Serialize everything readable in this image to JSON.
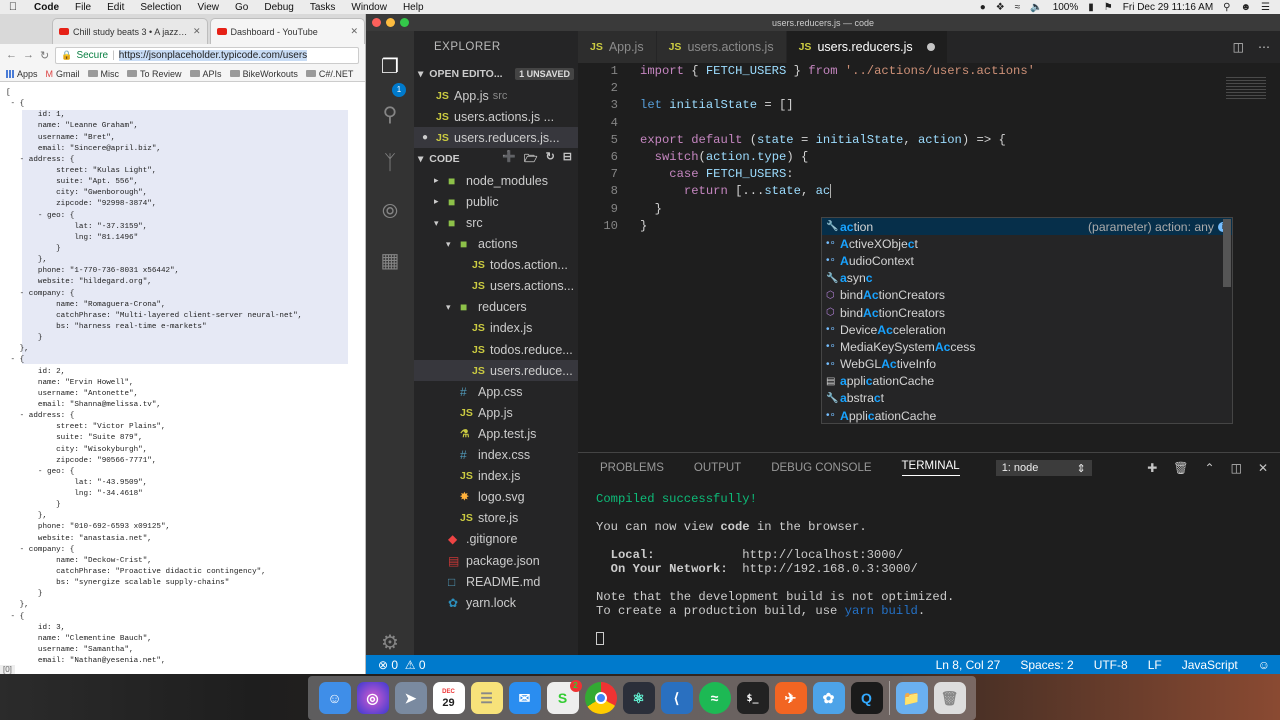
{
  "menubar": {
    "app": "Code",
    "items": [
      "File",
      "Edit",
      "Selection",
      "View",
      "Go",
      "Debug",
      "Tasks",
      "Window",
      "Help"
    ],
    "battery": "100%",
    "clock": "Fri Dec 29  11:16 AM"
  },
  "chrome": {
    "tabs": [
      {
        "title": "Chill study beats 3 • A jazz & l"
      },
      {
        "title": "Dashboard - YouTube"
      }
    ],
    "secure_label": "Secure",
    "url": "https://jsonplaceholder.typicode.com/users",
    "bookmarks": [
      "Apps",
      "Gmail",
      "Misc",
      "To Review",
      "APIs",
      "BikeWorkouts",
      "C#/.NET"
    ],
    "status": "[0]",
    "json_lines": [
      "[",
      " - {",
      "       id: 1,",
      "       name: \"Leanne Graham\",",
      "       username: \"Bret\",",
      "       email: \"Sincere@april.biz\",",
      "   - address: {",
      "           street: \"Kulas Light\",",
      "           suite: \"Apt. 556\",",
      "           city: \"Gwenborough\",",
      "           zipcode: \"92998-3874\",",
      "       - geo: {",
      "               lat: \"-37.3159\",",
      "               lng: \"81.1496\"",
      "           }",
      "       },",
      "       phone: \"1-770-736-8031 x56442\",",
      "       website: \"hildegard.org\",",
      "   - company: {",
      "           name: \"Romaguera-Crona\",",
      "           catchPhrase: \"Multi-layered client-server neural-net\",",
      "           bs: \"harness real-time e-markets\"",
      "       }",
      "   },",
      " - {",
      "       id: 2,",
      "       name: \"Ervin Howell\",",
      "       username: \"Antonette\",",
      "       email: \"Shanna@melissa.tv\",",
      "   - address: {",
      "           street: \"Victor Plains\",",
      "           suite: \"Suite 879\",",
      "           city: \"Wisokyburgh\",",
      "           zipcode: \"90566-7771\",",
      "       - geo: {",
      "               lat: \"-43.9509\",",
      "               lng: \"-34.4618\"",
      "           }",
      "       },",
      "       phone: \"010-692-6593 x09125\",",
      "       website: \"anastasia.net\",",
      "   - company: {",
      "           name: \"Deckow-Crist\",",
      "           catchPhrase: \"Proactive didactic contingency\",",
      "           bs: \"synergize scalable supply-chains\"",
      "       }",
      "   },",
      " - {",
      "       id: 3,",
      "       name: \"Clementine Bauch\",",
      "       username: \"Samantha\",",
      "       email: \"Nathan@yesenia.net\","
    ]
  },
  "vscode": {
    "window_title": "users.reducers.js — code",
    "explorer_title": "EXPLORER",
    "open_editors_label": "OPEN EDITO...",
    "unsaved_badge": "1 UNSAVED",
    "open_editors": [
      {
        "name": "App.js",
        "detail": "src"
      },
      {
        "name": "users.actions.js ...",
        "detail": ""
      },
      {
        "name": "users.reducers.js...",
        "detail": ""
      }
    ],
    "folder_label": "CODE",
    "tree": [
      {
        "name": "node_modules",
        "kind": "folder",
        "depth": 1,
        "open": false
      },
      {
        "name": "public",
        "kind": "folder",
        "depth": 1,
        "open": false
      },
      {
        "name": "src",
        "kind": "folder",
        "depth": 1,
        "open": true
      },
      {
        "name": "actions",
        "kind": "folder",
        "depth": 2,
        "open": true
      },
      {
        "name": "todos.action...",
        "kind": "js",
        "depth": 3
      },
      {
        "name": "users.actions...",
        "kind": "js",
        "depth": 3
      },
      {
        "name": "reducers",
        "kind": "folder",
        "depth": 2,
        "open": true
      },
      {
        "name": "index.js",
        "kind": "js",
        "depth": 3
      },
      {
        "name": "todos.reduce...",
        "kind": "js",
        "depth": 3
      },
      {
        "name": "users.reduce...",
        "kind": "js",
        "depth": 3,
        "selected": true
      },
      {
        "name": "App.css",
        "kind": "css",
        "depth": 2
      },
      {
        "name": "App.js",
        "kind": "js",
        "depth": 2
      },
      {
        "name": "App.test.js",
        "kind": "test",
        "depth": 2
      },
      {
        "name": "index.css",
        "kind": "css",
        "depth": 2
      },
      {
        "name": "index.js",
        "kind": "js",
        "depth": 2
      },
      {
        "name": "logo.svg",
        "kind": "svg",
        "depth": 2
      },
      {
        "name": "store.js",
        "kind": "js",
        "depth": 2
      },
      {
        "name": ".gitignore",
        "kind": "git",
        "depth": 1
      },
      {
        "name": "package.json",
        "kind": "npm",
        "depth": 1
      },
      {
        "name": "README.md",
        "kind": "md",
        "depth": 1
      },
      {
        "name": "yarn.lock",
        "kind": "yarn",
        "depth": 1
      }
    ],
    "editor_tabs": [
      {
        "name": "App.js",
        "active": false
      },
      {
        "name": "users.actions.js",
        "active": false
      },
      {
        "name": "users.reducers.js",
        "active": true
      }
    ],
    "line_numbers": [
      "1",
      "2",
      "3",
      "4",
      "5",
      "6",
      "7",
      "8",
      "9",
      "10"
    ],
    "code": {
      "l1_import": "import",
      "l1_brace_open": " { ",
      "l1_name": "FETCH_USERS",
      "l1_brace_close": " } ",
      "l1_from": "from",
      "l1_path": " '../actions/users.actions'",
      "l3_let": "let",
      "l3_var": " initialState",
      "l3_rest": " = []",
      "l5_export": "export",
      "l5_default": " default",
      "l5_paren": " (",
      "l5_state": "state",
      "l5_eq": " = ",
      "l5_init": "initialState",
      "l5_comma": ", ",
      "l5_action": "action",
      "l5_arrow": ") => {",
      "l6_switch": "switch",
      "l6_paren": "(",
      "l6_action": "action",
      "l6_type": ".type",
      "l6_rest": ") {",
      "l7_case": "case",
      "l7_name": " FETCH_USERS",
      "l7_colon": ":",
      "l8_return": "return",
      "l8_open": " [...",
      "l8_state": "state",
      "l8_comma": ", ",
      "l8_ac": "ac",
      "l9_close": "}",
      "l10_close": "}"
    },
    "suggestions": [
      {
        "match": "ac",
        "rest": "tion",
        "icon": "key",
        "detail": "(parameter) action: any"
      },
      {
        "pre": "",
        "match": "A",
        "mid": "ctiveXObje",
        "match2": "c",
        "rest": "t",
        "icon": "var"
      },
      {
        "pre": "",
        "match": "A",
        "mid": "udioContext",
        "match2": "",
        "rest": "",
        "icon": "var"
      },
      {
        "pre": "",
        "match": "a",
        "mid": "syn",
        "match2": "c",
        "rest": "",
        "icon": "key"
      },
      {
        "pre": "bind",
        "match": "Ac",
        "mid": "tionCreators",
        "match2": "",
        "rest": "",
        "icon": "mth"
      },
      {
        "pre": "bind",
        "match": "Ac",
        "mid": "tionCreators",
        "match2": "",
        "rest": "",
        "icon": "mth"
      },
      {
        "pre": "Device",
        "match": "Ac",
        "mid": "celeration",
        "match2": "",
        "rest": "",
        "icon": "var"
      },
      {
        "pre": "MediaKeySystem",
        "match": "Ac",
        "mid": "cess",
        "match2": "",
        "rest": "",
        "icon": "var"
      },
      {
        "pre": "WebGL",
        "match": "Ac",
        "mid": "tiveInfo",
        "match2": "",
        "rest": "",
        "icon": "var"
      },
      {
        "pre": "",
        "match": "a",
        "mid": "ppli",
        "match2": "c",
        "rest": "ationCache",
        "icon": "prop"
      },
      {
        "pre": "",
        "match": "a",
        "mid": "bstra",
        "match2": "c",
        "rest": "t",
        "icon": "key"
      },
      {
        "pre": "",
        "match": "A",
        "mid": "ppli",
        "match2": "c",
        "rest": "ationCache",
        "icon": "var"
      }
    ],
    "panel_tabs": [
      "PROBLEMS",
      "OUTPUT",
      "DEBUG CONSOLE",
      "TERMINAL"
    ],
    "terminal_select": "1: node",
    "terminal": {
      "compiled": "Compiled successfully!",
      "view_pre": "You can now view ",
      "view_app": "code",
      "view_post": " in the browser.",
      "local_label": "  Local:",
      "local_url": "            http://localhost:3000/",
      "network_label": "  On Your Network:",
      "network_url": "  http://192.168.0.3:3000/",
      "note1": "Note that the development build is not optimized.",
      "note2_pre": "To create a production build, use ",
      "note2_cmd": "yarn build",
      "note2_post": "."
    },
    "status": {
      "errors": "0",
      "warnings": "0",
      "position": "Ln 8, Col 27",
      "spaces": "Spaces: 2",
      "encoding": "UTF-8",
      "eol": "LF",
      "language": "JavaScript"
    }
  },
  "dock": {
    "calendar_month": "DEC",
    "calendar_day": "29",
    "slack_badge": "2"
  }
}
